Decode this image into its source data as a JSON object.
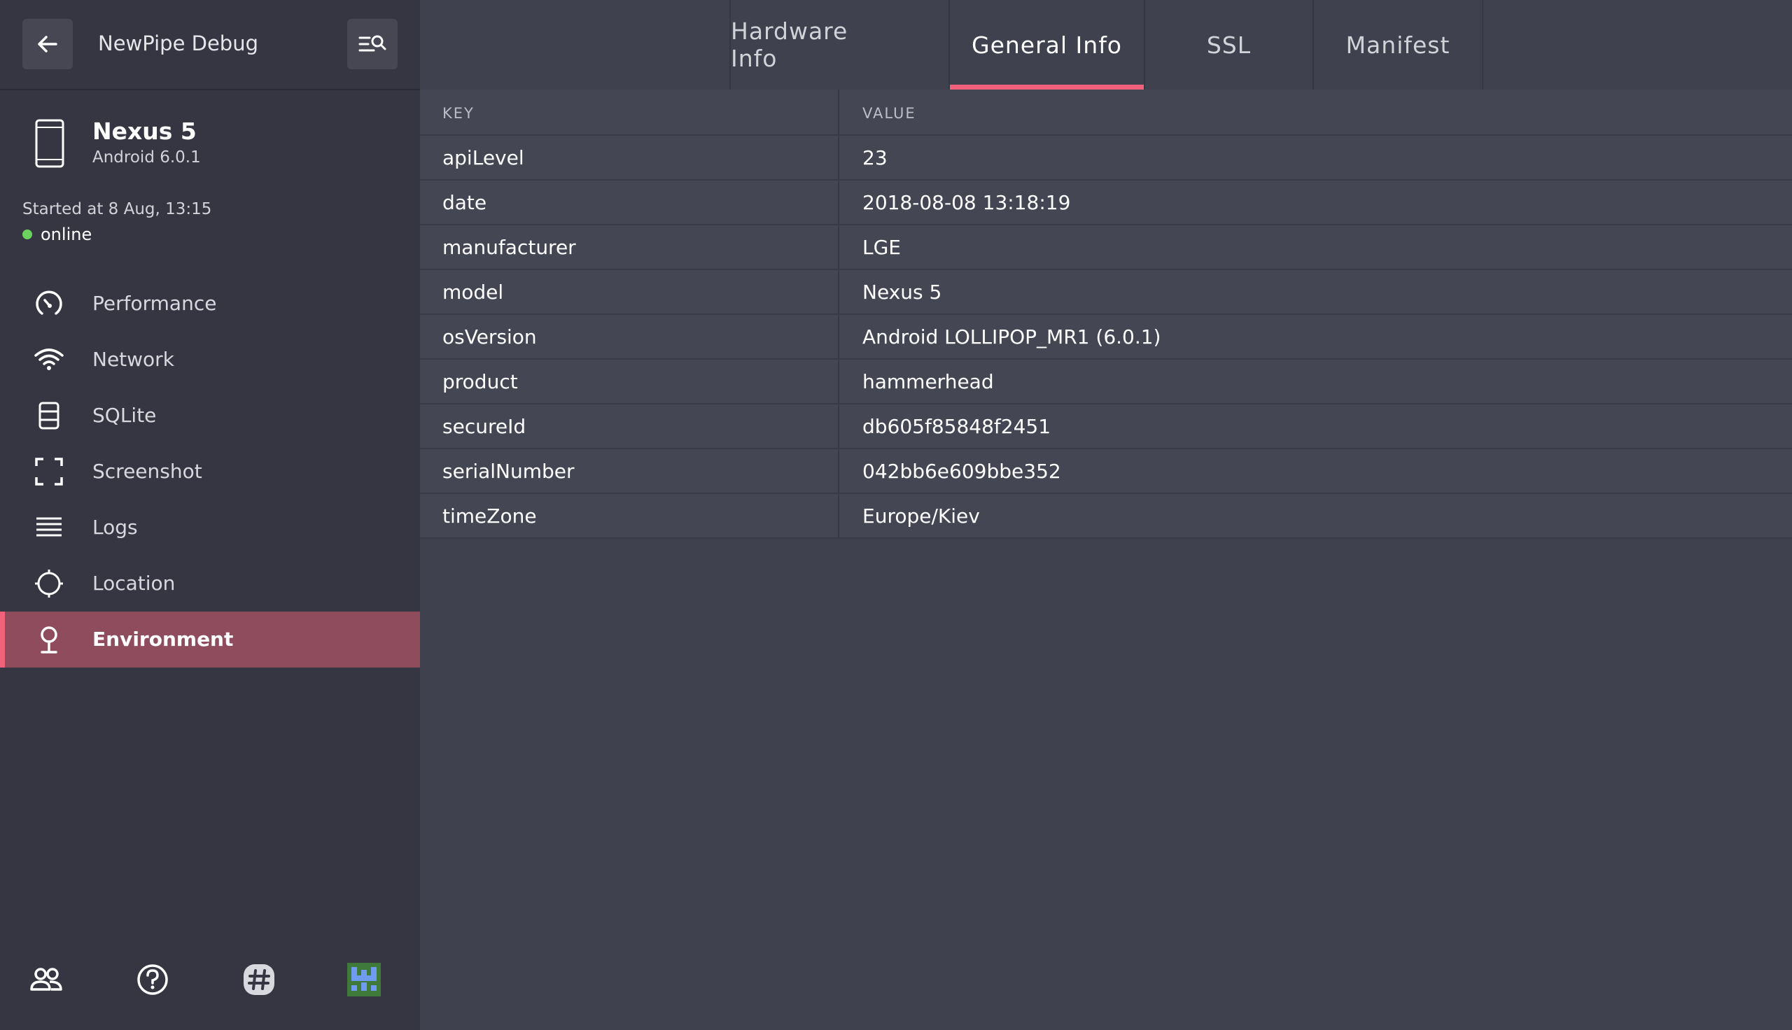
{
  "app": {
    "title": "NewPipe Debug"
  },
  "device": {
    "name": "Nexus 5",
    "os": "Android 6.0.1",
    "started": "Started at 8 Aug, 13:15",
    "status": "online"
  },
  "nav": {
    "items": [
      {
        "label": "Performance",
        "icon": "gauge-icon"
      },
      {
        "label": "Network",
        "icon": "wifi-icon"
      },
      {
        "label": "SQLite",
        "icon": "database-icon"
      },
      {
        "label": "Screenshot",
        "icon": "screenshot-icon"
      },
      {
        "label": "Logs",
        "icon": "list-icon"
      },
      {
        "label": "Location",
        "icon": "crosshair-icon"
      },
      {
        "label": "Environment",
        "icon": "environment-icon",
        "active": true
      }
    ]
  },
  "tabs": [
    {
      "label": "Hardware Info"
    },
    {
      "label": "General Info",
      "active": true
    },
    {
      "label": "SSL"
    },
    {
      "label": "Manifest"
    }
  ],
  "table": {
    "headers": {
      "key": "KEY",
      "value": "VALUE"
    },
    "rows": [
      {
        "key": "apiLevel",
        "value": "23"
      },
      {
        "key": "date",
        "value": "2018-08-08 13:18:19"
      },
      {
        "key": "manufacturer",
        "value": "LGE"
      },
      {
        "key": "model",
        "value": "Nexus 5"
      },
      {
        "key": "osVersion",
        "value": "Android LOLLIPOP_MR1 (6.0.1)"
      },
      {
        "key": "product",
        "value": "hammerhead"
      },
      {
        "key": "secureId",
        "value": "db605f85848f2451"
      },
      {
        "key": "serialNumber",
        "value": "042bb6e609bbe352"
      },
      {
        "key": "timeZone",
        "value": "Europe/Kiev"
      }
    ]
  },
  "colors": {
    "accent": "#f2617a",
    "active_bg": "#8f4c5c",
    "online": "#6cd15f"
  },
  "footer": {
    "icons": [
      "users-icon",
      "help-icon",
      "slack-icon",
      "app-avatar-icon"
    ]
  }
}
